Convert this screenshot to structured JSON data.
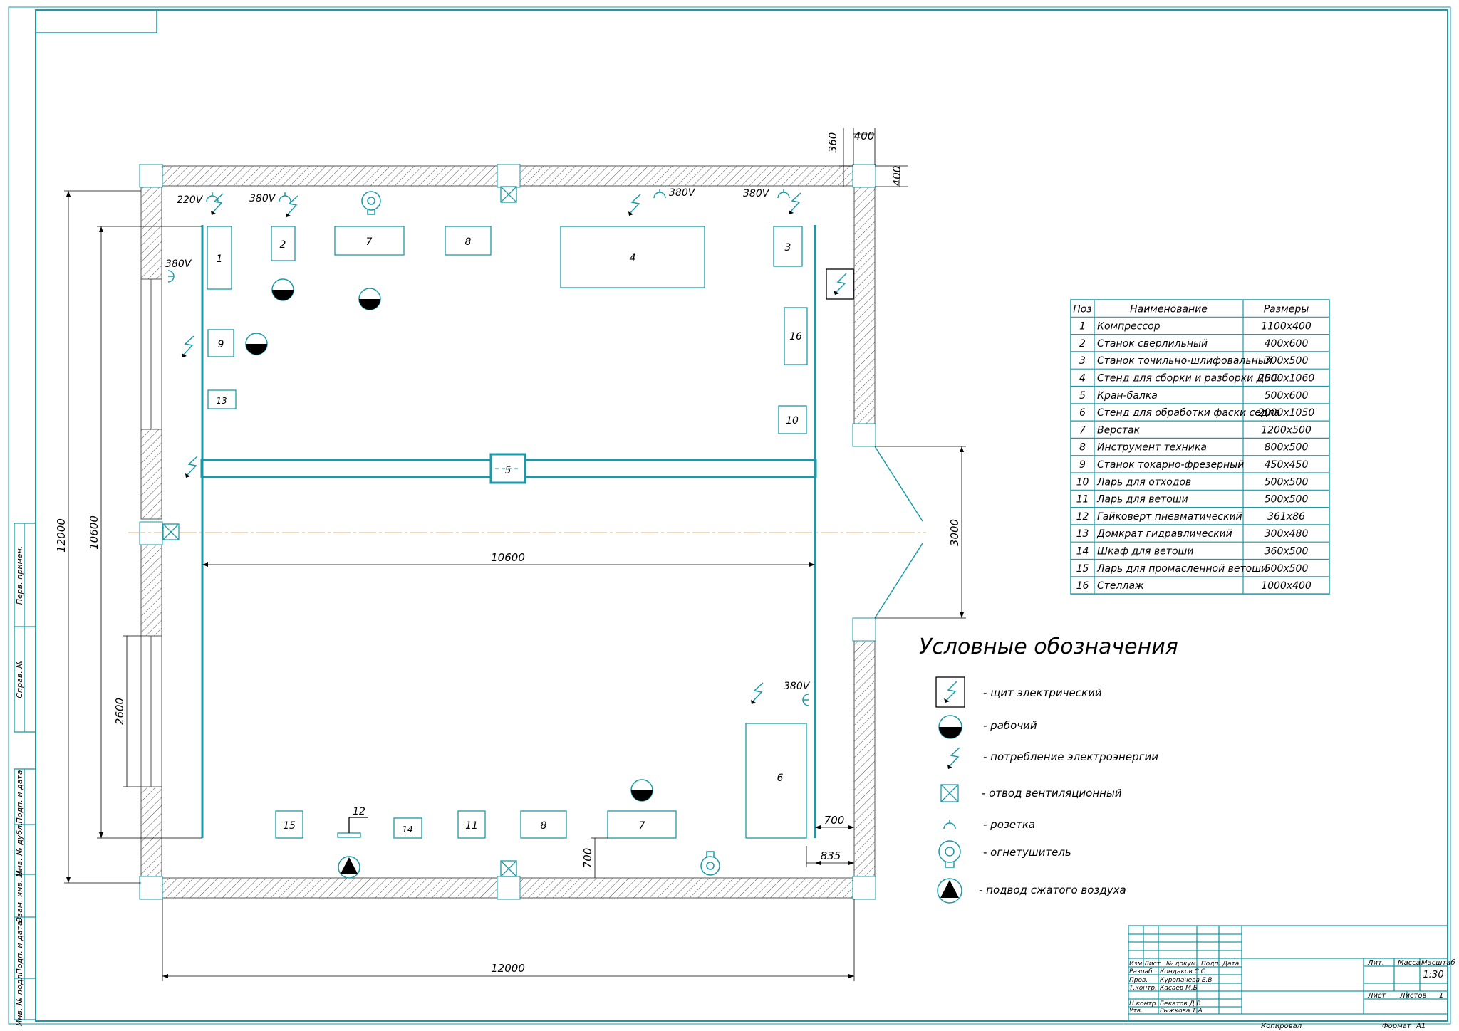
{
  "plan": {
    "voltage_220": "220V",
    "voltage_380": "380V",
    "dims": {
      "d360": "360",
      "d400a": "400",
      "d400b": "400",
      "d12000v": "12000",
      "d10600v": "10600",
      "d2600": "2600",
      "d10600h": "10600",
      "d3000": "3000",
      "d700a": "700",
      "d835": "835",
      "d700b": "700",
      "d12000h": "12000"
    },
    "positions": [
      "1",
      "2",
      "7",
      "8",
      "4",
      "3",
      "16",
      "9",
      "13",
      "10",
      "5",
      "15",
      "12",
      "14",
      "11",
      "8",
      "7",
      "6"
    ]
  },
  "spec_table": {
    "headers": [
      "Поз",
      "Наименование",
      "Размеры"
    ],
    "rows": [
      [
        "1",
        "Компрессор",
        "1100х400"
      ],
      [
        "2",
        "Станок сверлильный",
        "400х600"
      ],
      [
        "3",
        "Станок точильно-шлифовальный",
        "700х500"
      ],
      [
        "4",
        "Стенд для сборки и разборки ДВС",
        "2500х1060"
      ],
      [
        "5",
        "Кран-балка",
        "500х600"
      ],
      [
        "6",
        "Стенд для обработки фаски седла",
        "2000х1050"
      ],
      [
        "7",
        "Верстак",
        "1200х500"
      ],
      [
        "8",
        "Инструмент техника",
        "800х500"
      ],
      [
        "9",
        "Станок токарно-фрезерный",
        "450х450"
      ],
      [
        "10",
        "Ларь для отходов",
        "500х500"
      ],
      [
        "11",
        "Ларь для ветоши",
        "500х500"
      ],
      [
        "12",
        "Гайковерт пневматический",
        "361х86"
      ],
      [
        "13",
        "Домкрат гидравлический",
        "300х480"
      ],
      [
        "14",
        "Шкаф для ветоши",
        "360х500"
      ],
      [
        "15",
        "Ларь для промасленной ветоши",
        "500х500"
      ],
      [
        "16",
        "Стеллаж",
        "1000х400"
      ]
    ]
  },
  "legend": {
    "title": "Условные обозначения",
    "items": [
      {
        "icon": "electric-panel-icon",
        "text": "- щит электрический"
      },
      {
        "icon": "worker-icon",
        "text": "- рабочий"
      },
      {
        "icon": "power-consumption-icon",
        "text": "- потребление электроэнергии"
      },
      {
        "icon": "ventilation-outlet-icon",
        "text": "- отвод вентиляционный"
      },
      {
        "icon": "socket-icon",
        "text": "- розетка"
      },
      {
        "icon": "fire-extinguisher-icon",
        "text": "- огнетушитель"
      },
      {
        "icon": "compressed-air-icon",
        "text": "- подвод сжатого воздуха"
      }
    ]
  },
  "side_stamp": [
    "Перв. примен.",
    "Справ. №",
    "Подп. и дата",
    "Инв. № дубл.",
    "Взам. инв. №",
    "Подп. и дата",
    "Инв. № подл."
  ],
  "title_block": {
    "col_heads": [
      "Изм",
      "Лист",
      "№ докум.",
      "Подп.",
      "Дата"
    ],
    "people": [
      [
        "Разраб.",
        "Кондаков С.С"
      ],
      [
        "Пров.",
        "Куропачева Е.В"
      ],
      [
        "Т.контр.",
        "Касаев М.Б"
      ],
      [
        "Н.контр.",
        "Бекатов Д.В"
      ],
      [
        "Утв.",
        "Рыжкова Т.А"
      ]
    ],
    "lit": "Лит.",
    "mass": "Масса",
    "scale_head": "Масштаб",
    "scale": "1:30",
    "sheet": "Лист",
    "sheets": "Листов",
    "sheets_val": "1",
    "copied": "Копировал",
    "format": "Формат",
    "format_val": "А1"
  },
  "colors": {
    "line": "#1a9aa8",
    "ink": "#000000"
  }
}
